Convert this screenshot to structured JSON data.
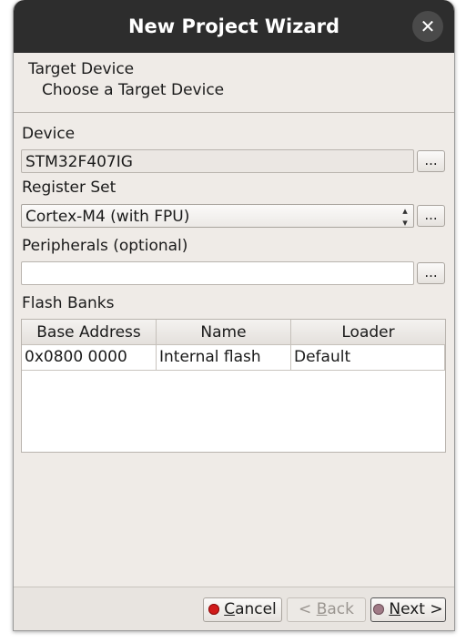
{
  "window": {
    "title": "New Project Wizard",
    "close_glyph": "✕"
  },
  "header": {
    "title": "Target Device",
    "subtitle": "Choose a Target Device"
  },
  "device": {
    "label": "Device",
    "value": "STM32F407IG",
    "browse_label": "..."
  },
  "register_set": {
    "label": "Register Set",
    "selected": "Cortex-M4 (with FPU)",
    "browse_label": "..."
  },
  "peripherals": {
    "label": "Peripherals (optional)",
    "value": "",
    "browse_label": "..."
  },
  "flash_banks": {
    "label": "Flash Banks",
    "columns": [
      "Base Address",
      "Name",
      "Loader"
    ],
    "rows": [
      [
        "0x0800 0000",
        "Internal flash",
        "Default"
      ]
    ]
  },
  "footer": {
    "cancel": {
      "underlined": "C",
      "rest": "ancel"
    },
    "back": {
      "prefix": "< ",
      "underlined": "B",
      "rest": "ack"
    },
    "next": {
      "underlined": "N",
      "rest": "ext >"
    }
  },
  "colors": {
    "titlebar": "#2d2d2d",
    "window_bg": "#efebe7",
    "cancel_dot": "#d11a1a",
    "next_dot": "#a07a86"
  },
  "icons": {
    "close": "close-icon",
    "select_arrows": "updown-arrows-icon",
    "cancel": "red-dot-icon",
    "next": "mauve-dot-icon"
  }
}
